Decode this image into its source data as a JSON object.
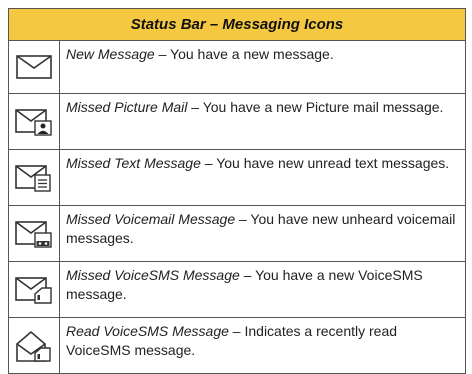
{
  "title": "Status Bar – Messaging Icons",
  "accent_color": "#f5c842",
  "items": [
    {
      "icon": "envelope-icon",
      "name": "New Message",
      "text": "You have a new message."
    },
    {
      "icon": "envelope-picture-icon",
      "name": "Missed Picture Mail",
      "text": "You have a new Picture mail message."
    },
    {
      "icon": "envelope-text-icon",
      "name": "Missed Text Message",
      "text": "You have new unread text messages."
    },
    {
      "icon": "envelope-voicemail-icon",
      "name": "Missed Voicemail Message",
      "text": "You have new unheard voicemail messages."
    },
    {
      "icon": "envelope-voicesms-icon",
      "name": "Missed VoiceSMS Message",
      "text": "You have a new VoiceSMS message."
    },
    {
      "icon": "open-envelope-voicesms-icon",
      "name": "Read VoiceSMS Message",
      "text": "Indicates a recently read VoiceSMS message."
    }
  ],
  "separator": " – "
}
